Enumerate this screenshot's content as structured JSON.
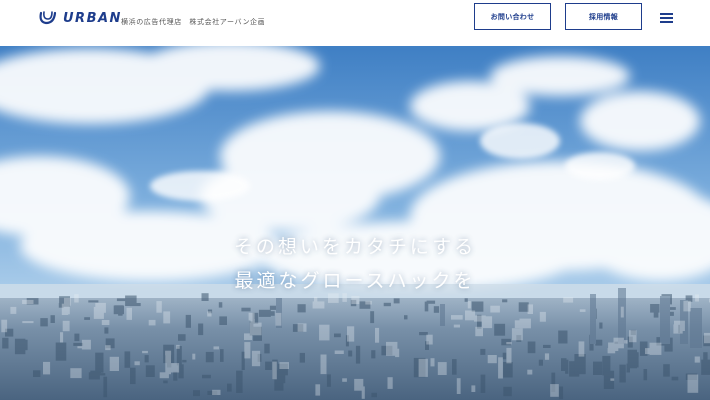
{
  "header": {
    "logo_text": "URBAN",
    "tagline": "横浜の広告代理店　株式会社アーバン企画",
    "contact_label": "お問い合わせ",
    "recruit_label": "採用情報",
    "menu_icon": "hamburger-menu-icon"
  },
  "hero": {
    "line1": "その想いをカタチにする",
    "line2": "最適なグロースハックを"
  },
  "colors": {
    "brand": "#1e3d8c",
    "sky_top": "#3f7fc4",
    "sky_bottom": "#b9d6ee",
    "city": "#5f7d99"
  }
}
